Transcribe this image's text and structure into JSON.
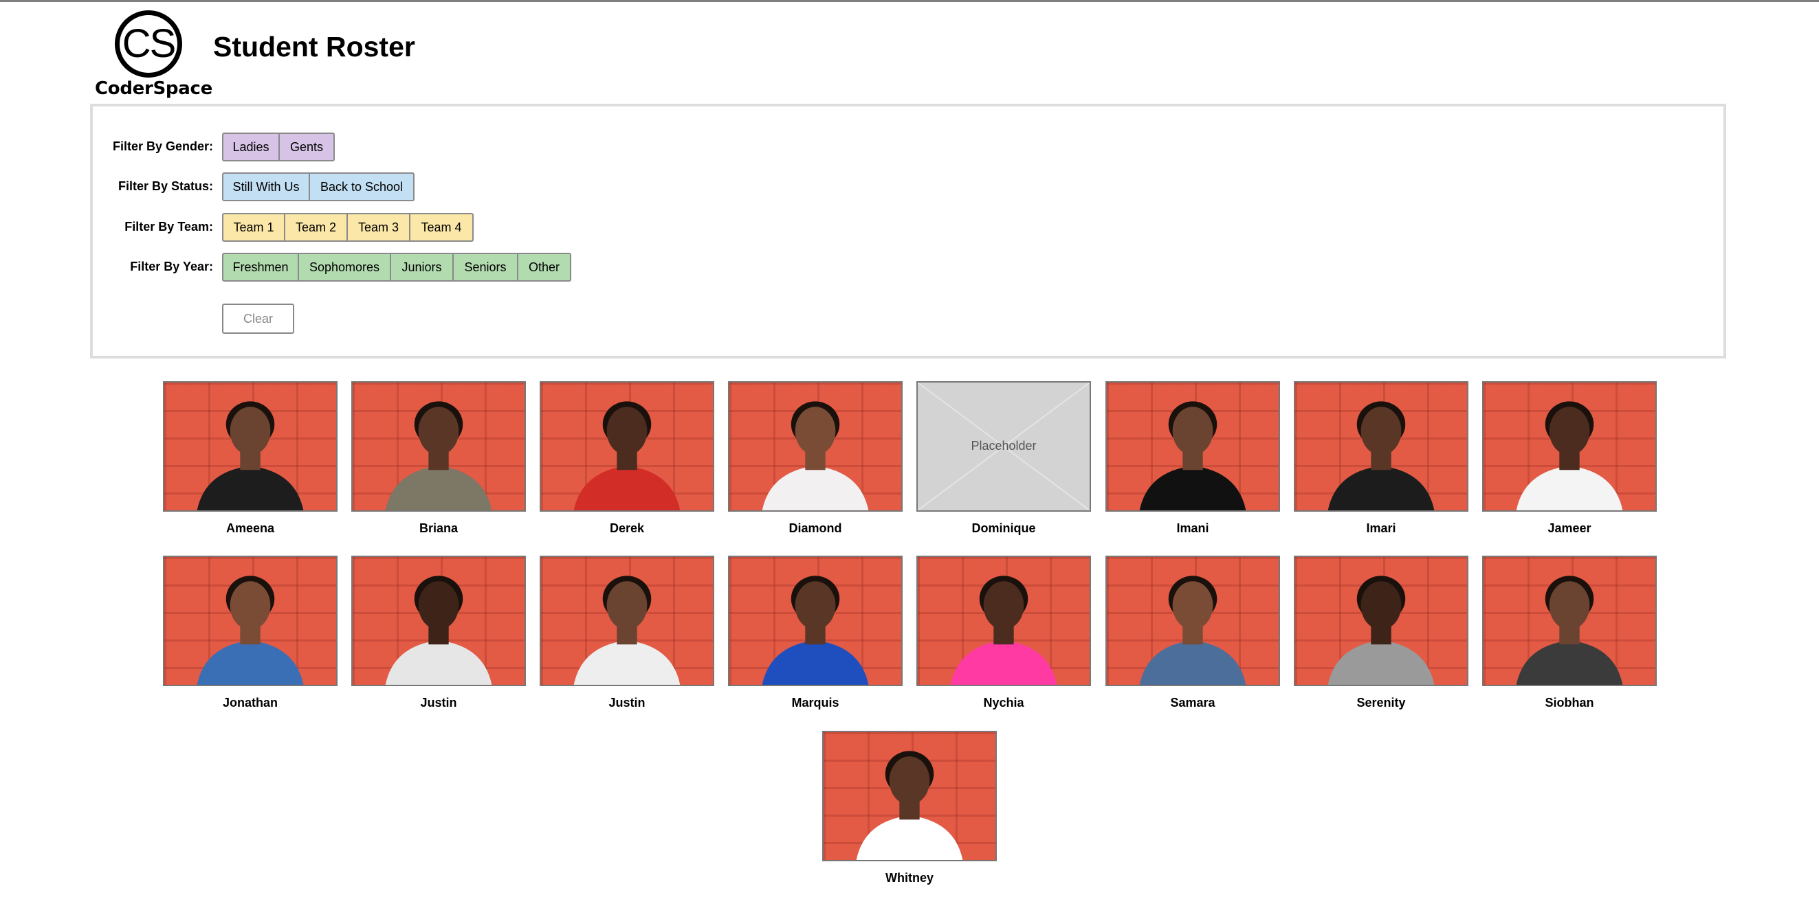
{
  "header": {
    "logo_mark": "CS",
    "logo_text": "CoderSpace",
    "title": "Student Roster"
  },
  "filters": {
    "gender": {
      "label": "Filter By Gender:",
      "color": "#d6c3e6",
      "options": [
        "Ladies",
        "Gents"
      ]
    },
    "status": {
      "label": "Filter By Status:",
      "color": "#c3dff4",
      "options": [
        "Still With Us",
        "Back to School"
      ]
    },
    "team": {
      "label": "Filter By Team:",
      "color": "#fbe7a8",
      "options": [
        "Team 1",
        "Team 2",
        "Team 3",
        "Team 4"
      ]
    },
    "year": {
      "label": "Filter By Year:",
      "color": "#b3dbb0",
      "options": [
        "Freshmen",
        "Sophomores",
        "Juniors",
        "Seniors",
        "Other"
      ]
    },
    "clear_label": "Clear"
  },
  "colors": {
    "photo_background": "#e35a45",
    "placeholder_background": "#d3d3d3"
  },
  "students": [
    {
      "name": "Ameena"
    },
    {
      "name": "Briana"
    },
    {
      "name": "Derek"
    },
    {
      "name": "Diamond"
    },
    {
      "name": "Dominique",
      "placeholder": "Placeholder"
    },
    {
      "name": "Imani"
    },
    {
      "name": "Imari"
    },
    {
      "name": "Jameer"
    },
    {
      "name": "Jonathan"
    },
    {
      "name": "Justin"
    },
    {
      "name": "Justin"
    },
    {
      "name": "Marquis"
    },
    {
      "name": "Nychia"
    },
    {
      "name": "Samara"
    },
    {
      "name": "Serenity"
    },
    {
      "name": "Siobhan"
    },
    {
      "name": "Whitney"
    }
  ]
}
